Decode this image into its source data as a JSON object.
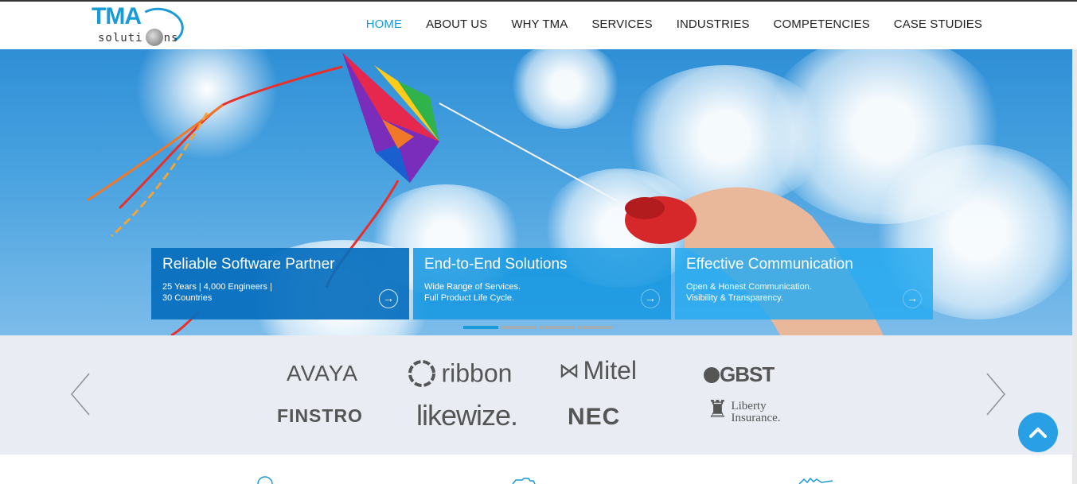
{
  "brand": {
    "name": "TMA",
    "tagline": "solutions"
  },
  "nav": {
    "items": [
      "HOME",
      "ABOUT US",
      "WHY TMA",
      "SERVICES",
      "INDUSTRIES",
      "COMPETENCIES",
      "CASE STUDIES"
    ],
    "active": "HOME"
  },
  "hero": {
    "cards": [
      {
        "title": "Reliable Software Partner",
        "line1": "25 Years | 4,000 Engineers |",
        "line2": "30 Countries"
      },
      {
        "title": "End-to-End Solutions",
        "line1": "Wide Range of Services.",
        "line2": "Full Product Life Cycle."
      },
      {
        "title": "Effective Communication",
        "line1": "Open & Honest Communication.",
        "line2": "Visibility & Transparency."
      }
    ],
    "slide_count": 4,
    "active_slide": 1
  },
  "partners": {
    "logos": [
      "AVAYA",
      "ribbon",
      "Mitel",
      "GBST",
      "FINSTRO",
      "likewize.",
      "NEC",
      "Liberty",
      "Insurance."
    ]
  },
  "colors": {
    "accent": "#1a9ad6",
    "partners_bg": "#e9edf3",
    "to_top": "#29a0e6"
  },
  "icons": {
    "prev": "chevron-left-icon",
    "next": "chevron-right-icon",
    "to_top": "chevron-up-icon",
    "card_arrow": "arrow-right-circle-icon"
  }
}
